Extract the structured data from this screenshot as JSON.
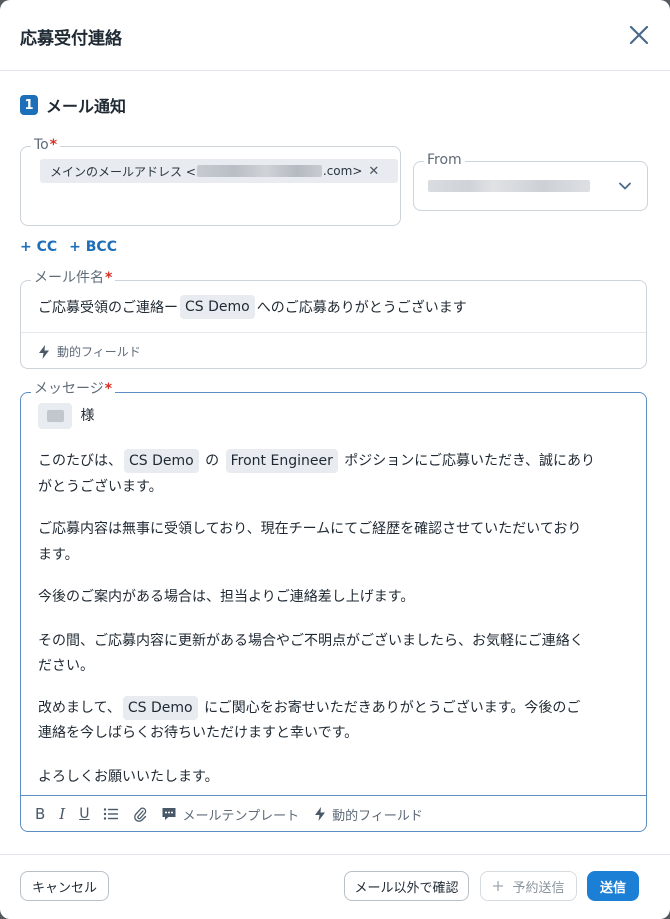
{
  "dialog": {
    "title": "応募受付連絡"
  },
  "section": {
    "number": "1",
    "title": "メール通知"
  },
  "to": {
    "label": "To",
    "required_mark": "*",
    "chip_prefix": "メインのメールアドレス <",
    "chip_suffix": ".com>",
    "chip_remove": "✕"
  },
  "from": {
    "label": "From"
  },
  "cc_links": {
    "cc": "+ CC",
    "bcc": "+ BCC"
  },
  "subject": {
    "label": "メール件名",
    "required_mark": "*",
    "text_before": "ご応募受領のご連絡ー",
    "tag": "CS Demo",
    "text_after": "へのご応募ありがとうございます",
    "dynamic_field": "動的フィールド"
  },
  "message": {
    "label": "メッセージ",
    "required_mark": "*",
    "greeting_suffix": "様",
    "p1_before": "このたびは、",
    "p1_tag1": "CS Demo",
    "p1_mid": "の",
    "p1_tag2": "Front Engineer",
    "p1_after": "ポジションにご応募いただき、誠にあり",
    "p1_line2": "がとうございます。",
    "p2_line1": "ご応募内容は無事に受領しており、現在チームにてご経歴を確認させていただいており",
    "p2_line2": "ます。",
    "p3": "今後のご案内がある場合は、担当よりご連絡差し上げます。",
    "p4_line1": "その間、ご応募内容に更新がある場合やご不明点がございましたら、お気軽にご連絡く",
    "p4_line2": "ださい。",
    "p5_before": "改めまして、",
    "p5_tag": "CS Demo",
    "p5_after": "にご関心をお寄せいただきありがとうございます。今後のご",
    "p5_line2": "連絡を今しばらくお待ちいただけますと幸いです。",
    "p6": "よろしくお願いいたします。"
  },
  "toolbar": {
    "bold": "B",
    "italic": "I",
    "underline": "U",
    "template": "メールテンプレート",
    "dynamic_field": "動的フィールド"
  },
  "footer": {
    "cancel": "キャンセル",
    "confirm_other": "メール以外で確認",
    "schedule_send": "予約送信",
    "send": "送信"
  }
}
